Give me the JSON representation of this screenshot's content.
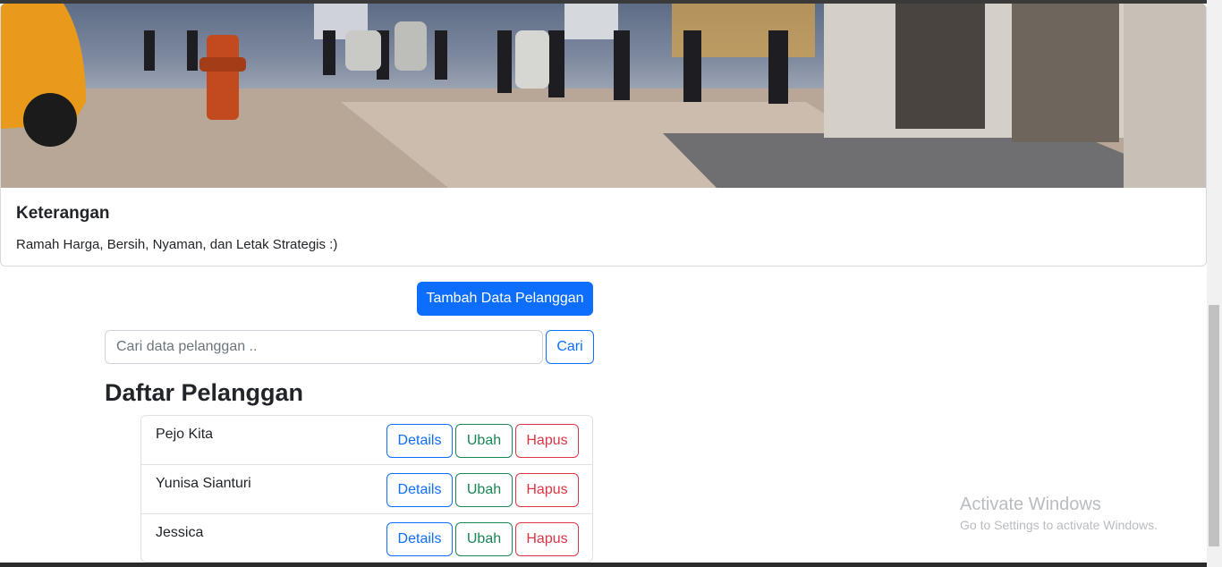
{
  "card": {
    "title": "Keterangan",
    "text": "Ramah Harga, Bersih, Nyaman, dan Letak Strategis :)"
  },
  "actions": {
    "add_label": "Tambah Data Pelanggan"
  },
  "search": {
    "placeholder": "Cari data pelanggan ..",
    "value": "",
    "button_label": "Cari"
  },
  "list": {
    "heading": "Daftar Pelanggan",
    "items": [
      {
        "name": "Pejo Kita",
        "details": "Details",
        "edit": "Ubah",
        "delete": "Hapus"
      },
      {
        "name": "Yunisa Sianturi",
        "details": "Details",
        "edit": "Ubah",
        "delete": "Hapus"
      },
      {
        "name": "Jessica",
        "details": "Details",
        "edit": "Ubah",
        "delete": "Hapus"
      }
    ]
  },
  "watermark": {
    "title": "Activate Windows",
    "subtitle": "Go to Settings to activate Windows."
  },
  "colors": {
    "primary": "#0d6efd",
    "success": "#198754",
    "danger": "#dc3545"
  }
}
